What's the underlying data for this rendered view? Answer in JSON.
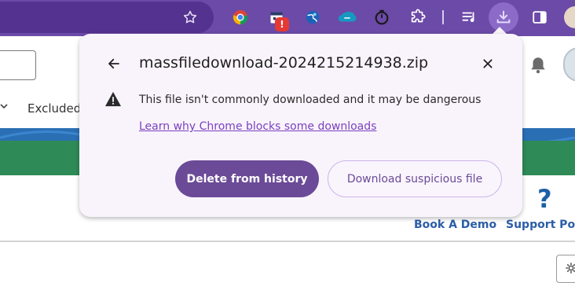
{
  "download_bubble": {
    "filename": "massfiledownload-2024215214938.zip",
    "warning": "This file isn't commonly downloaded and it may be dangerous",
    "learn_link": "Learn why Chrome blocks some downloads",
    "delete_label": "Delete from history",
    "download_label": "Download suspicious file",
    "icons": [
      "back-arrow-icon",
      "close-icon",
      "warning-icon"
    ]
  },
  "toolbar": {
    "extension_badge": "!",
    "icons": [
      "star-icon",
      "extension-chrome-icon",
      "extension-calendar-icon",
      "extension-globe-icon",
      "extension-salesforce-icon",
      "extension-timer-icon",
      "extensions-puzzle-icon",
      "media-control-icon",
      "download-icon",
      "side-panel-icon",
      "profile-avatar"
    ]
  },
  "page": {
    "tab_label": "Excluded",
    "book_demo": "Book A Demo",
    "support": "Support Port",
    "help_glyph": "?"
  },
  "colors": {
    "toolbar": "#6c4aa8",
    "bubble_bg": "#f9f4fc",
    "primary_button": "#6b4a97",
    "link": "#7b3fbf",
    "brand_blue": "#2b5ea8",
    "green_band": "#2e8b57"
  }
}
